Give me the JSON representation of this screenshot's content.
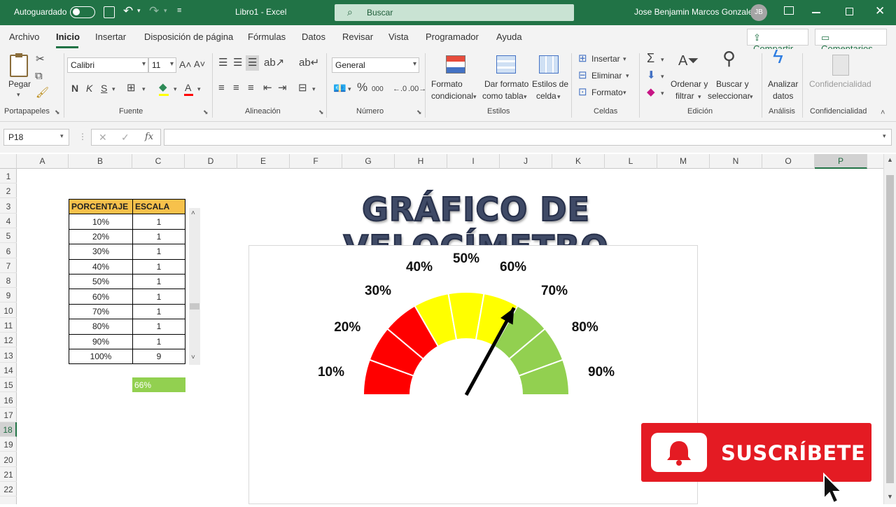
{
  "titlebar": {
    "autosave_label": "Autoguardado",
    "doc_title": "Libro1  -  Excel",
    "search_placeholder": "Buscar",
    "user_name": "Jose Benjamin Marcos Gonzales",
    "user_initials": "JB",
    "accent": "#217346"
  },
  "menu": {
    "items": [
      "Archivo",
      "Inicio",
      "Insertar",
      "Disposición de página",
      "Fórmulas",
      "Datos",
      "Revisar",
      "Vista",
      "Programador",
      "Ayuda"
    ],
    "active": "Inicio",
    "share_label": "Compartir",
    "comments_label": "Comentarios"
  },
  "ribbon": {
    "paste_label": "Pegar",
    "font_name": "Calibri",
    "font_size": "11",
    "number_format": "General",
    "cond_format_l1": "Formato",
    "cond_format_l2": "condicional",
    "table_format_l1": "Dar formato",
    "table_format_l2": "como tabla",
    "cell_styles_l1": "Estilos de",
    "cell_styles_l2": "celda",
    "insert_label": "Insertar",
    "delete_label": "Eliminar",
    "format_label": "Formato",
    "sort_l1": "Ordenar y",
    "sort_l2": "filtrar",
    "find_l1": "Buscar y",
    "find_l2": "seleccionar",
    "analyze_l1": "Analizar",
    "analyze_l2": "datos",
    "confidential_label": "Confidencialidad",
    "groups": {
      "clipboard": "Portapapeles",
      "font": "Fuente",
      "alignment": "Alineación",
      "number": "Número",
      "styles": "Estilos",
      "cells": "Celdas",
      "editing": "Edición",
      "analysis": "Análisis",
      "confidentiality": "Confidencialidad"
    }
  },
  "formula_bar": {
    "name_box": "P18",
    "fx": "fx",
    "content": ""
  },
  "grid": {
    "columns": [
      "A",
      "B",
      "C",
      "D",
      "E",
      "F",
      "G",
      "H",
      "I",
      "J",
      "K",
      "L",
      "M",
      "N",
      "O",
      "P"
    ],
    "selected_column": "P",
    "rows": [
      "1",
      "2",
      "3",
      "4",
      "5",
      "6",
      "7",
      "8",
      "9",
      "10",
      "11",
      "12",
      "13",
      "14",
      "15",
      "16",
      "17",
      "18",
      "19",
      "20",
      "21",
      "22"
    ],
    "selected_row": "18"
  },
  "table": {
    "headers": [
      "PORCENTAJE",
      "ESCALA"
    ],
    "rows": [
      [
        "10%",
        "1"
      ],
      [
        "20%",
        "1"
      ],
      [
        "30%",
        "1"
      ],
      [
        "40%",
        "1"
      ],
      [
        "50%",
        "1"
      ],
      [
        "60%",
        "1"
      ],
      [
        "70%",
        "1"
      ],
      [
        "80%",
        "1"
      ],
      [
        "90%",
        "1"
      ],
      [
        "100%",
        "9"
      ]
    ],
    "header_color": "#f7c14b"
  },
  "value_cell": {
    "text": "66%",
    "color": "#92d050"
  },
  "chart": {
    "title": "GRÁFICO DE VELOCÍMETRO",
    "segment_labels": [
      "10%",
      "20%",
      "30%",
      "40%",
      "50%",
      "60%",
      "70%",
      "80%",
      "90%"
    ],
    "needle_value": 0.66,
    "colors": {
      "red": "#ff0000",
      "yellow": "#ffff00",
      "green": "#92d050"
    }
  },
  "chart_data": {
    "type": "pie",
    "title": "GRÁFICO DE VELOCÍMETRO",
    "categories": [
      "10%",
      "20%",
      "30%",
      "40%",
      "50%",
      "60%",
      "70%",
      "80%",
      "90%",
      "100%"
    ],
    "values": [
      1,
      1,
      1,
      1,
      1,
      1,
      1,
      1,
      1,
      9
    ],
    "segment_colors": [
      "#ff0000",
      "#ff0000",
      "#ff0000",
      "#ffff00",
      "#ffff00",
      "#ffff00",
      "#92d050",
      "#92d050",
      "#92d050",
      "none"
    ],
    "needle_value": 0.66
  },
  "overlay": {
    "subscribe_label": "SUSCRÍBETE",
    "color": "#e41b23"
  }
}
